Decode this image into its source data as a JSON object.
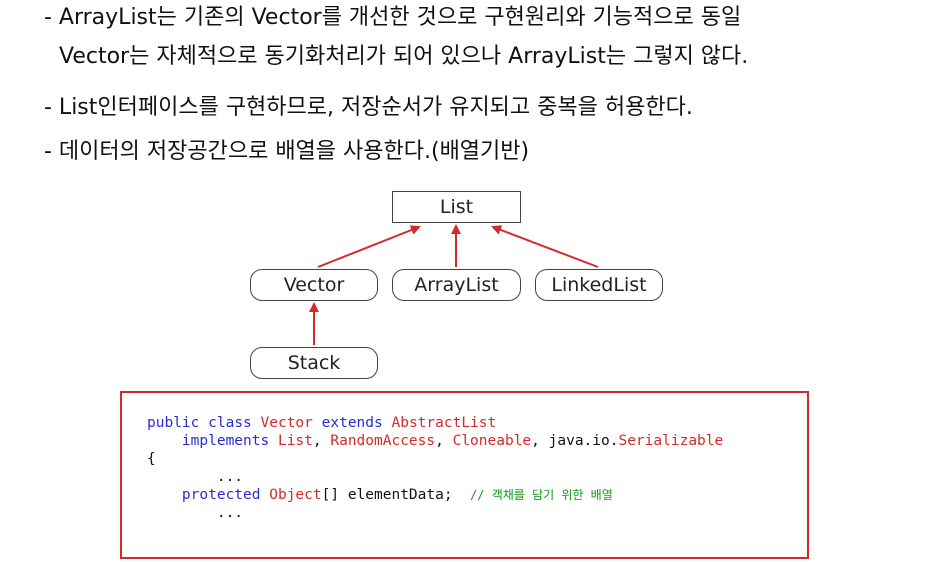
{
  "bullets": {
    "b1_line1": "- ArrayList는 기존의 Vector를 개선한 것으로 구현원리와 기능적으로 동일",
    "b1_line2": "Vector는 자체적으로 동기화처리가 되어 있으나 ArrayList는 그렇지 않다.",
    "b2": "- List인터페이스를 구현하므로, 저장순서가 유지되고 중복을 허용한다.",
    "b3": "- 데이터의 저장공간으로 배열을 사용한다.(배열기반)"
  },
  "diagram": {
    "list": "List",
    "vector": "Vector",
    "arraylist": "ArrayList",
    "linkedlist": "LinkedList",
    "stack": "Stack",
    "arrow_color": "#d42a2a"
  },
  "code": {
    "l1_kw1": "public",
    "l1_kw2": "class",
    "l1_type1": "Vector",
    "l1_kw3": "extends",
    "l1_type2": "AbstractList",
    "l2_kw": "implements",
    "l2_t1": "List",
    "l2_t2": "RandomAccess",
    "l2_t3": "Cloneable",
    "l2_pkg": "java.io.",
    "l2_t4": "Serializable",
    "l3": "{",
    "l4": "...",
    "l5_kw": "protected",
    "l5_type": "Object",
    "l5_rest": "[] elementData;",
    "l5_comment": "// 객채를 담기 위한 배열",
    "l6": "..."
  }
}
